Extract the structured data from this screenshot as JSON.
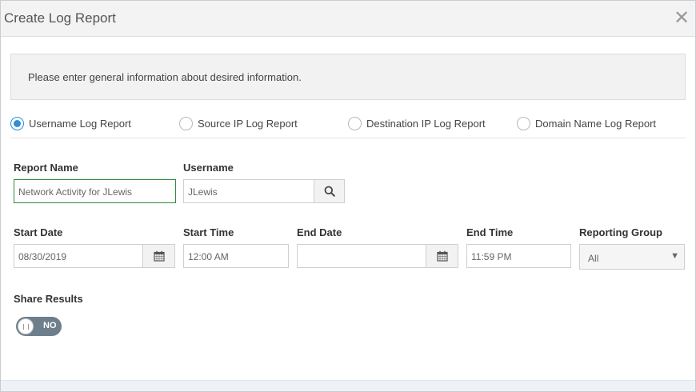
{
  "dialog": {
    "title": "Create Log Report",
    "close_glyph": "✕",
    "info_text": "Please enter general information about desired information."
  },
  "report_types": [
    {
      "label": "Username Log Report",
      "checked": true
    },
    {
      "label": "Source IP Log Report",
      "checked": false
    },
    {
      "label": "Destination IP Log Report",
      "checked": false
    },
    {
      "label": "Domain Name Log Report",
      "checked": false
    }
  ],
  "fields": {
    "report_name": {
      "label": "Report Name",
      "value": "Network Activity for JLewis"
    },
    "username": {
      "label": "Username",
      "value": "JLewis",
      "search_icon": "search-icon"
    },
    "start_date": {
      "label": "Start Date",
      "value": "08/30/2019",
      "icon": "calendar-icon"
    },
    "start_time": {
      "label": "Start Time",
      "value": "12:00 AM"
    },
    "end_date": {
      "label": "End Date",
      "value": "",
      "icon": "calendar-icon"
    },
    "end_time": {
      "label": "End Time",
      "value": "11:59 PM"
    },
    "reporting_group": {
      "label": "Reporting Group",
      "value": "All"
    }
  },
  "share_results": {
    "label": "Share Results",
    "state_label": "NO",
    "enabled": false
  },
  "colors": {
    "accent": "#2f8fd8",
    "focus_border": "#2e8b3e",
    "toggle_off": "#6d7e8c"
  }
}
